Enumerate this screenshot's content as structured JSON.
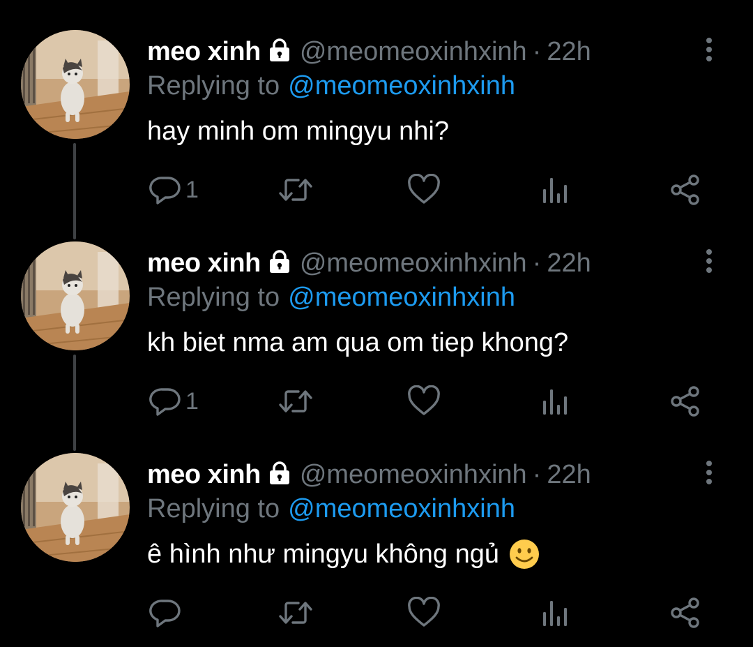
{
  "colors": {
    "background": "#000000",
    "name": "#ffffff",
    "muted": "#6e767d",
    "link": "#1d9bf0",
    "thread_line": "#3e4144",
    "emoji": "#ffcc4d"
  },
  "tweets": [
    {
      "author": {
        "name": "meo xinh",
        "handle": "@meomeoxinhxinh",
        "protected_icon": "lock-icon",
        "avatar": "cat-avatar"
      },
      "dot": "·",
      "time": "22h",
      "replying_prefix": "Replying to",
      "replying_to": "@meomeoxinhxinh",
      "text": "hay minh om mingyu nhi?",
      "emoji": null,
      "reply_count": "1"
    },
    {
      "author": {
        "name": "meo xinh",
        "handle": "@meomeoxinhxinh",
        "protected_icon": "lock-icon",
        "avatar": "cat-avatar"
      },
      "dot": "·",
      "time": "22h",
      "replying_prefix": "Replying to",
      "replying_to": "@meomeoxinhxinh",
      "text": "kh biet nma am qua om tiep khong?",
      "emoji": null,
      "reply_count": "1"
    },
    {
      "author": {
        "name": "meo xinh",
        "handle": "@meomeoxinhxinh",
        "protected_icon": "lock-icon",
        "avatar": "cat-avatar"
      },
      "dot": "·",
      "time": "22h",
      "replying_prefix": "Replying to",
      "replying_to": "@meomeoxinhxinh",
      "text": "ê hình như mingyu không ngủ",
      "emoji": "slightly-smiling-face-icon",
      "reply_count": ""
    }
  ],
  "action_icons": [
    "reply-icon",
    "retweet-icon",
    "like-icon",
    "analytics-icon",
    "share-icon"
  ]
}
